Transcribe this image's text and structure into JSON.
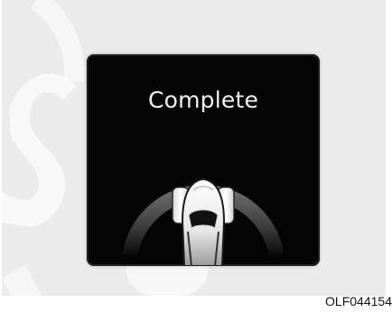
{
  "display": {
    "status_text": "Complete",
    "graphic_icon": "car-top-view-icon",
    "background_color": "#050505"
  },
  "figure": {
    "code": "OLF044154"
  }
}
